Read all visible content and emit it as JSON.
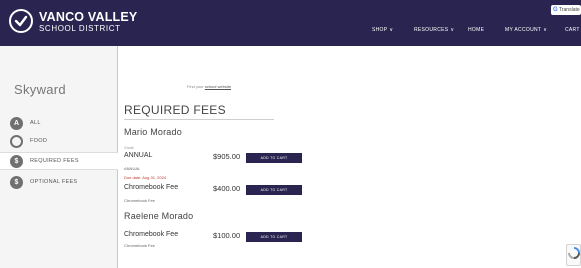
{
  "header": {
    "brand_line1": "VANCO VALLEY",
    "brand_line2": "SCHOOL DISTRICT",
    "logo_icon": "checkmark-circle-icon",
    "nav": [
      {
        "label": "SHOP",
        "dropdown": true
      },
      {
        "label": "RESOURCES",
        "dropdown": true
      },
      {
        "label": "HOME",
        "dropdown": false
      },
      {
        "label": "MY ACCOUNT",
        "dropdown": true
      },
      {
        "label": "CART",
        "dropdown": false
      }
    ],
    "translate": {
      "g": "G",
      "label": "Translate"
    }
  },
  "sidebar": {
    "title": "Skyward",
    "items": [
      {
        "label": "ALL",
        "icon": "A"
      },
      {
        "label": "FOOD",
        "icon": ""
      },
      {
        "label": "REQUIRED FEES",
        "icon": "$"
      },
      {
        "label": "OPTIONAL FEES",
        "icon": "$"
      }
    ]
  },
  "main": {
    "find_prefix": "Find your",
    "find_link": "school website",
    "title": "REQUIRED FEES",
    "students": [
      {
        "name": "Mario Morado",
        "grade": "Grade",
        "fees": [
          {
            "name": "ANNUAL",
            "sub": "ANNUAL",
            "due": "Due date: Aug 31, 2024",
            "price": "$905.00",
            "button": "ADD TO CART"
          },
          {
            "name": "Chromebook Fee",
            "sub": "Chromebook Fee",
            "price": "$400.00",
            "button": "ADD TO CART"
          }
        ]
      },
      {
        "name": "Raelene Morado",
        "fees": [
          {
            "name": "Chromebook Fee",
            "sub": "Chromebook Fee",
            "price": "$100.00",
            "button": "ADD TO CART"
          }
        ]
      }
    ]
  },
  "colors": {
    "header": "#2a2550",
    "button": "#2a2550",
    "due": "#c0392b"
  }
}
